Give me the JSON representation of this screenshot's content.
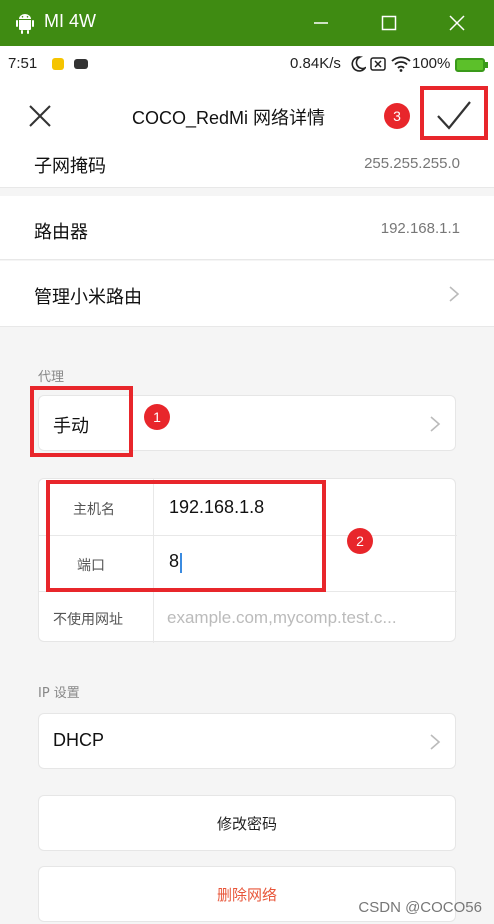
{
  "window": {
    "title": "MI 4W"
  },
  "status_bar": {
    "time": "7:51",
    "speed": "0.84K/s",
    "battery": "100%"
  },
  "header": {
    "title": "COCO_RedMi 网络详情"
  },
  "rows": {
    "subnet": {
      "label": "子网掩码",
      "value": "255.255.255.0"
    },
    "router": {
      "label": "路由器",
      "value": "192.168.1.1"
    },
    "manage": {
      "label": "管理小米路由"
    }
  },
  "proxy": {
    "section_title": "代理",
    "mode": "手动",
    "hostname_label": "主机名",
    "hostname_value": "192.168.1.8",
    "port_label": "端口",
    "port_value": "8",
    "bypass_label": "不使用网址",
    "bypass_placeholder": "example.com,mycomp.test.c..."
  },
  "ip": {
    "section_title": "IP 设置",
    "mode": "DHCP"
  },
  "buttons": {
    "change_password": "修改密码",
    "delete_network": "删除网络"
  },
  "annotations": {
    "one": "1",
    "two": "2",
    "three": "3"
  },
  "watermark": "CSDN @COCO56",
  "colors": {
    "title_bar": "#3f8b12",
    "annotation": "#e8262b",
    "danger_text": "#e8563a"
  }
}
